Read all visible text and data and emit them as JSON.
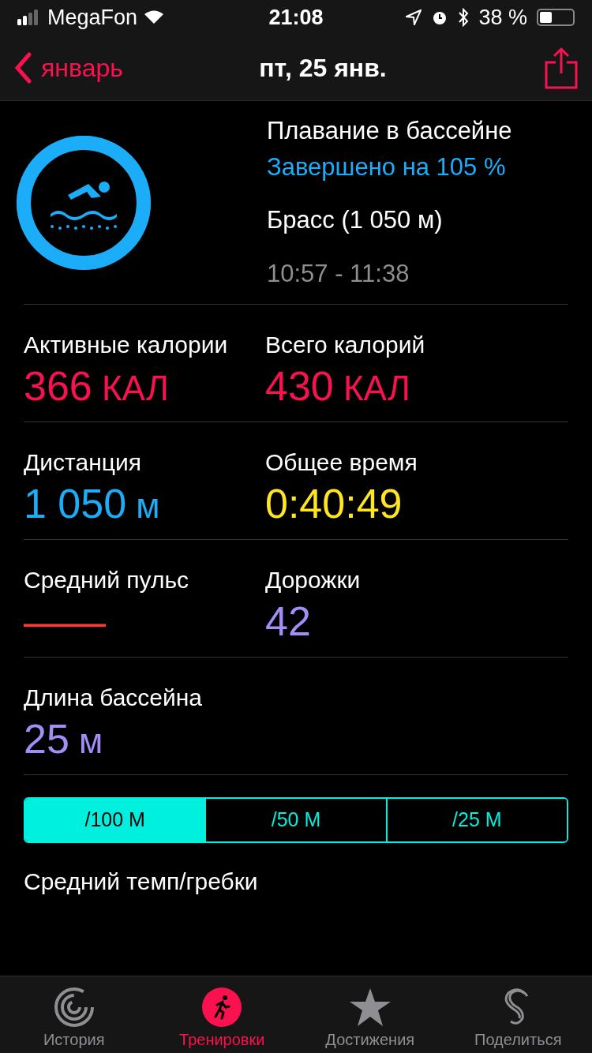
{
  "status_bar": {
    "carrier": "MegaFon",
    "time": "21:08",
    "battery": "38 %"
  },
  "nav": {
    "back": "январь",
    "title": "пт, 25 янв."
  },
  "workout": {
    "level": 1,
    "title": "Плавание в бассейне",
    "completion": "Завершено на 105 %",
    "stroke": "Брасс (1 050 м)",
    "time_range": "10:57 - 11:38"
  },
  "metrics": [
    [
      {
        "label": "Активные калории",
        "value": "366",
        "unit": "КАЛ",
        "color": "#fa114f"
      },
      {
        "label": "Всего калорий",
        "value": "430",
        "unit": "КАЛ",
        "color": "#fa114f"
      }
    ],
    [
      {
        "label": "Дистанция",
        "value": "1 050",
        "unit": "м",
        "color": "#1badf8"
      },
      {
        "label": "Общее время",
        "value": "0:40:49",
        "color": "#ffe620"
      }
    ],
    [
      {
        "label": "Средний пульс",
        "value": "——",
        "color": "#ff3b30"
      },
      {
        "label": "Дорожки",
        "value": "42",
        "color": "#a28ef5"
      }
    ],
    [
      {
        "label": "Длина бассейна",
        "value": "25",
        "unit": "м",
        "color": "#a28ef5"
      }
    ]
  ],
  "segments": [
    {
      "label": "/100 М",
      "selected": true
    },
    {
      "label": "/50 М",
      "selected": false
    },
    {
      "label": "/25 М",
      "selected": false
    }
  ],
  "section_title": "Средний темп/гребки",
  "tabs": [
    {
      "label": "История",
      "selected": false
    },
    {
      "label": "Тренировки",
      "selected": true
    },
    {
      "label": "Достижения",
      "selected": false
    },
    {
      "label": "Поделиться",
      "selected": false
    }
  ]
}
